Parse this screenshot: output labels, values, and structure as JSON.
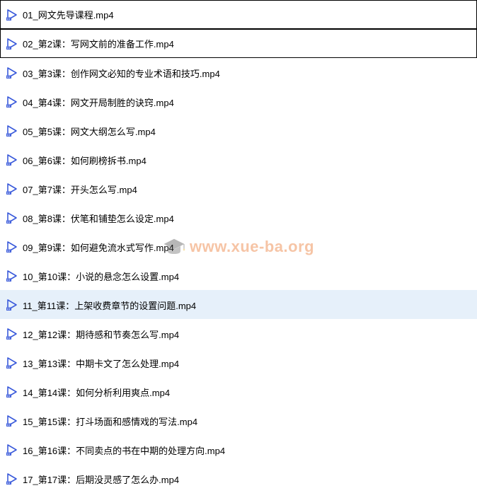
{
  "watermark": {
    "text": "www.xue-ba.org"
  },
  "files": [
    {
      "name": "01_网文先导课程.mp4",
      "bordered": true,
      "selected": false
    },
    {
      "name": "02_第2课：写网文前的准备工作.mp4",
      "bordered": true,
      "selected": false
    },
    {
      "name": "03_第3课：创作网文必知的专业术语和技巧.mp4",
      "bordered": false,
      "selected": false
    },
    {
      "name": "04_第4课：网文开局制胜的诀窍.mp4",
      "bordered": false,
      "selected": false
    },
    {
      "name": "05_第5课：网文大纲怎么写.mp4",
      "bordered": false,
      "selected": false
    },
    {
      "name": "06_第6课：如何刷榜拆书.mp4",
      "bordered": false,
      "selected": false
    },
    {
      "name": "07_第7课：开头怎么写.mp4",
      "bordered": false,
      "selected": false
    },
    {
      "name": "08_第8课：伏笔和铺垫怎么设定.mp4",
      "bordered": false,
      "selected": false
    },
    {
      "name": "09_第9课：如何避免流水式写作.mp4",
      "bordered": false,
      "selected": false
    },
    {
      "name": "10_第10课：小说的悬念怎么设置.mp4",
      "bordered": false,
      "selected": false
    },
    {
      "name": "11_第11课：上架收费章节的设置问题.mp4",
      "bordered": false,
      "selected": true
    },
    {
      "name": "12_第12课：期待感和节奏怎么写.mp4",
      "bordered": false,
      "selected": false
    },
    {
      "name": "13_第13课：中期卡文了怎么处理.mp4",
      "bordered": false,
      "selected": false
    },
    {
      "name": "14_第14课：如何分析利用爽点.mp4",
      "bordered": false,
      "selected": false
    },
    {
      "name": "15_第15课：打斗场面和感情戏的写法.mp4",
      "bordered": false,
      "selected": false
    },
    {
      "name": "16_第16课：不同卖点的书在中期的处理方向.mp4",
      "bordered": false,
      "selected": false
    },
    {
      "name": "17_第17课：后期没灵感了怎么办.mp4",
      "bordered": false,
      "selected": false
    }
  ]
}
